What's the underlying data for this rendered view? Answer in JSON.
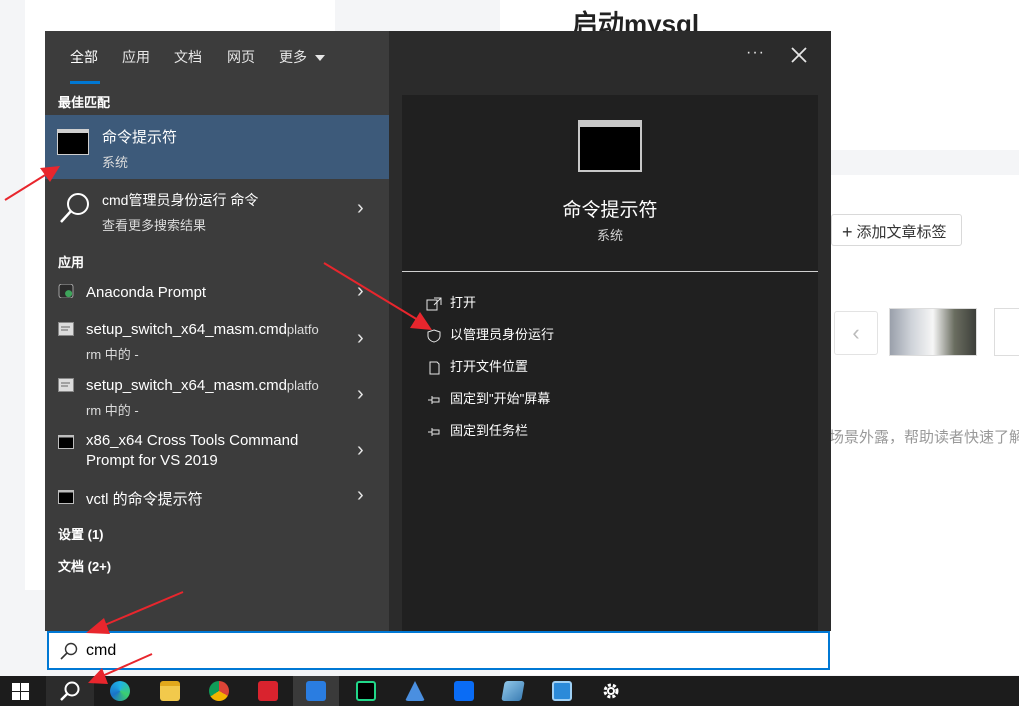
{
  "background_page": {
    "title": "启动mysql",
    "add_tag_button": "添加文章标签",
    "prev_arrow": "‹",
    "description_snippet": "场景外露，帮助读者快速了解"
  },
  "flyout": {
    "tabs": [
      {
        "label": "全部",
        "active": true
      },
      {
        "label": "应用",
        "active": false
      },
      {
        "label": "文档",
        "active": false
      },
      {
        "label": "网页",
        "active": false
      },
      {
        "label": "更多",
        "active": false
      }
    ],
    "more_options": "···",
    "best_match_header": "最佳匹配",
    "best_match": {
      "title": "命令提示符",
      "subtitle": "系统"
    },
    "web_result": {
      "title": "cmd管理员身份运行 命令",
      "subtitle": "查看更多搜索结果"
    },
    "apps_header": "应用",
    "apps": [
      {
        "title": "Anaconda Prompt",
        "line2": ""
      },
      {
        "title": "setup_switch_x64_masm.cmd",
        "suffix": "platfo",
        "line2": "rm 中的 -"
      },
      {
        "title": "setup_switch_x64_masm.cmd",
        "suffix": "platfo",
        "line2": "rm 中的 -"
      },
      {
        "title": "x86_x64 Cross Tools Command",
        "line2": "Prompt for VS 2019"
      },
      {
        "title": "vctl 的命令提示符",
        "line2": ""
      }
    ],
    "settings_header": "设置 (1)",
    "docs_header": "文档 (2+)",
    "preview": {
      "title": "命令提示符",
      "subtitle": "系统",
      "actions": [
        {
          "label": "打开",
          "icon": "open-icon"
        },
        {
          "label": "以管理员身份运行",
          "icon": "shield-icon"
        },
        {
          "label": "打开文件位置",
          "icon": "file-location-icon"
        },
        {
          "label": "固定到\"开始\"屏幕",
          "icon": "pin-icon"
        },
        {
          "label": "固定到任务栏",
          "icon": "pin-icon"
        }
      ]
    }
  },
  "search": {
    "value": "cmd"
  },
  "taskbar": {
    "icons": [
      "windows-start-icon",
      "search-icon",
      "edge-icon",
      "file-explorer-icon",
      "chrome-icon",
      "wps-icon",
      "feishu-icon",
      "pycharm-icon",
      "app-icon",
      "tencent-meeting-icon",
      "vmware-icon",
      "remote-desktop-icon",
      "settings-gear-icon"
    ]
  },
  "colors": {
    "accent": "#0078d4",
    "annotation": "#e8262d",
    "selection": "#3d5a7a"
  }
}
